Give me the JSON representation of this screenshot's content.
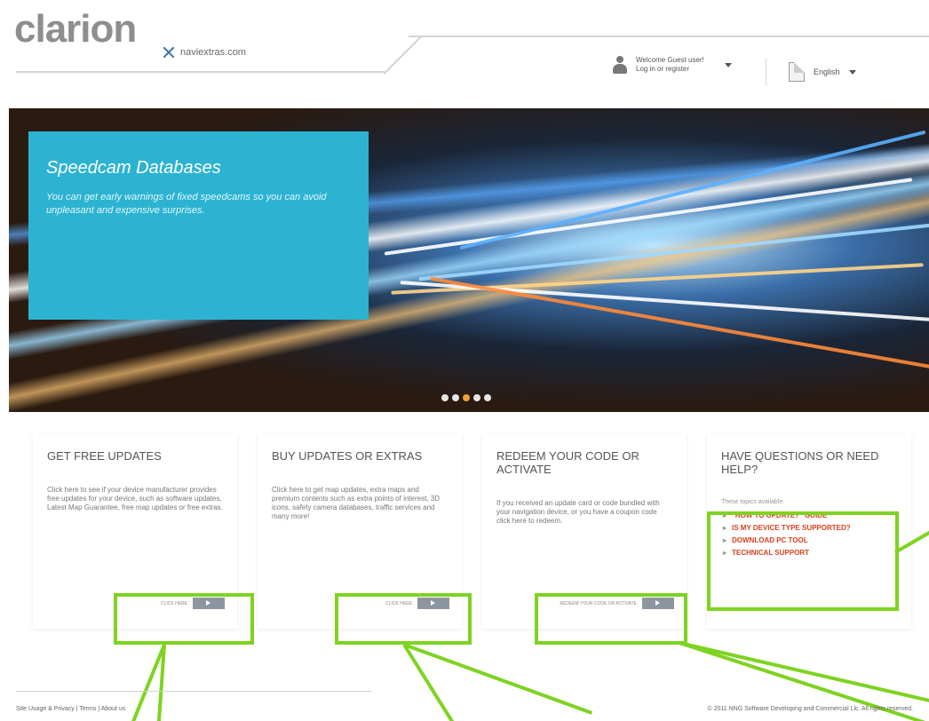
{
  "header": {
    "logo": "clarion",
    "navi_logo": "naviextras.com",
    "user_text": "Welcome Guest user! Log in or register",
    "language": "English"
  },
  "banner": {
    "title": "Speedcam Databases",
    "text": "You can get early warnings of fixed speedcams so you can avoid unpleasant and expensive surprises.",
    "dot_count": 5,
    "active_dot": 2
  },
  "panels": [
    {
      "title": "GET FREE UPDATES",
      "text": "Click here to see if your device manufacturer provides free updates for your device, such as software updates, Latest Map Guarantee, free map updates or free extras.",
      "button_label": "CLICK HERE"
    },
    {
      "title": "BUY UPDATES OR EXTRAS",
      "text": "Click here to get map updates, extra maps and premium contents such as extra points of interest, 3D icons, safety camera databases, traffic services and many more!",
      "button_label": "CLICK HERE"
    },
    {
      "title": "REDEEM YOUR CODE OR ACTIVATE",
      "text": "If you received an update card or code bundled with your navigation device, or you have a coupon code click here to redeem.",
      "button_label": "REDEEM YOUR CODE OR ACTIVATE"
    },
    {
      "title": "HAVE QUESTIONS OR NEED HELP?",
      "note": "These topics available:",
      "links": [
        "\"HOW TO UPDATE?\" GUIDE",
        "IS MY DEVICE TYPE SUPPORTED?",
        "DOWNLOAD PC TOOL",
        "TECHNICAL SUPPORT"
      ]
    }
  ],
  "footer": {
    "left": "Site Usage & Privacy | Terms | About us",
    "right": "© 2011 NNG Software Developing and Commercial Llc. All rights reserved."
  },
  "colors": {
    "accent": "#2cb3d1",
    "highlight": "#7ed321",
    "link": "#d9411e",
    "active_dot": "#f0a030"
  }
}
